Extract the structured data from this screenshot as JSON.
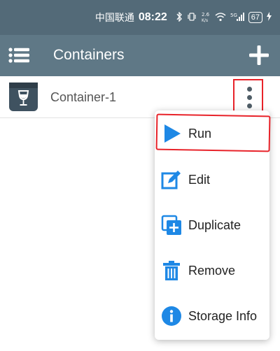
{
  "status_bar": {
    "carrier": "中国联通",
    "time": "08:22",
    "icons": [
      "bluetooth-icon",
      "vibrate-icon",
      "data-speed-icon",
      "wifi-icon",
      "5g-signal-icon",
      "battery-icon",
      "charging-icon"
    ],
    "data_speed": "2.6 K/s",
    "network": "5G",
    "battery": "67"
  },
  "app_bar": {
    "title": "Containers",
    "menu_icon": "hamburger-menu-icon",
    "add_icon": "plus-icon"
  },
  "containers": [
    {
      "name": "Container-1",
      "icon": "wine-glass-icon"
    }
  ],
  "popup_menu": {
    "items": [
      {
        "label": "Run",
        "icon": "play-icon"
      },
      {
        "label": "Edit",
        "icon": "edit-icon"
      },
      {
        "label": "Duplicate",
        "icon": "duplicate-icon"
      },
      {
        "label": "Remove",
        "icon": "trash-icon"
      },
      {
        "label": "Storage Info",
        "icon": "info-icon"
      }
    ]
  },
  "colors": {
    "status_bar": "#536a78",
    "app_bar": "#5f7886",
    "accent_blue": "#1e88e5",
    "annotation_red": "#e8232a"
  }
}
